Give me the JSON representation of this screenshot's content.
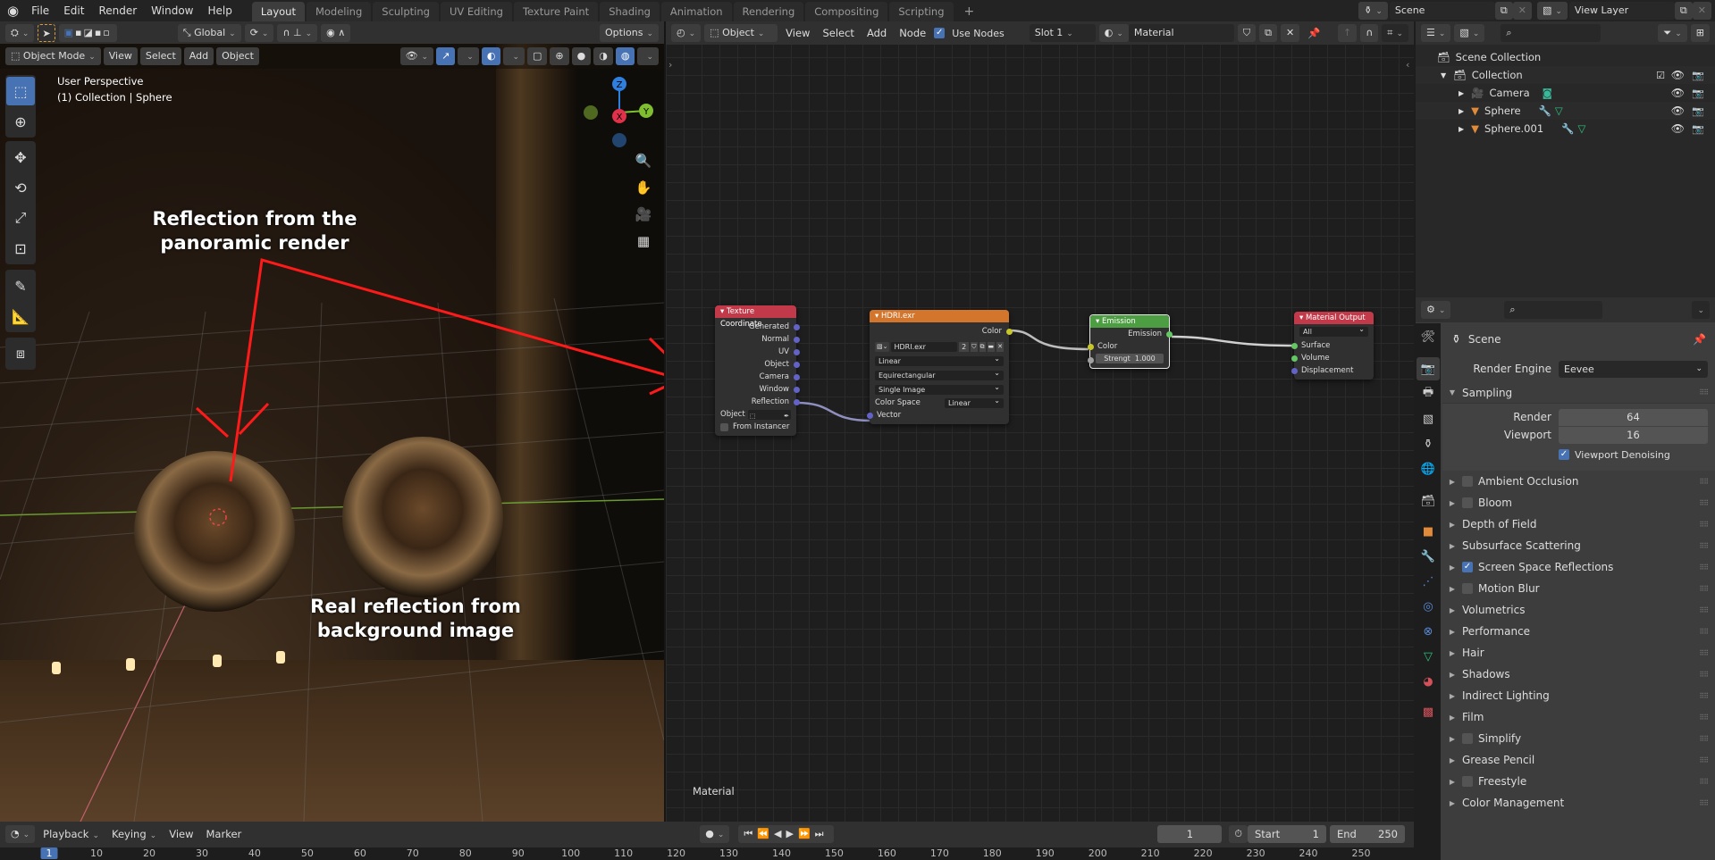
{
  "topbar": {
    "menus": [
      "File",
      "Edit",
      "Render",
      "Window",
      "Help"
    ],
    "workspaces": [
      "Layout",
      "Modeling",
      "Sculpting",
      "UV Editing",
      "Texture Paint",
      "Shading",
      "Animation",
      "Rendering",
      "Compositing",
      "Scripting"
    ],
    "active_workspace": "Layout",
    "add_tab": "+",
    "scene_name": "Scene",
    "view_layer": "View Layer"
  },
  "tool_header": {
    "transform_orientation": "Global",
    "options": "Options"
  },
  "viewport": {
    "mode": "Object Mode",
    "menus": [
      "View",
      "Select",
      "Add",
      "Object"
    ],
    "perspective": "User Perspective",
    "collection_info": "(1) Collection | Sphere",
    "gizmo_axes": {
      "z": "Z",
      "x": "X",
      "y": "Y"
    },
    "annotation_top": "Reflection from the panoramic render",
    "annotation_top_lines": [
      "Reflection from the",
      "panoramic render"
    ],
    "annotation_bottom_lines": [
      "Real reflection from",
      "background image"
    ]
  },
  "node_editor": {
    "object_type": "Object",
    "menus": [
      "View",
      "Select",
      "Add",
      "Node"
    ],
    "use_nodes_label": "Use Nodes",
    "use_nodes": true,
    "slot": "Slot 1",
    "material_name": "Material",
    "footer_label": "Material",
    "nodes": {
      "texcoord": {
        "title": "Texture Coordinate",
        "outputs": [
          "Generated",
          "Normal",
          "UV",
          "Object",
          "Camera",
          "Window",
          "Reflection"
        ],
        "object_label": "Object",
        "from_instancer": "From Instancer"
      },
      "image": {
        "title": "HDRI.exr",
        "output": "Color",
        "image_name": "HDRI.exr",
        "users": "2",
        "interpolation": "Linear",
        "projection": "Equirectangular",
        "source": "Single Image",
        "color_space_label": "Color Space",
        "color_space": "Linear",
        "input": "Vector"
      },
      "emission": {
        "title": "Emission",
        "output": "Emission",
        "color_input": "Color",
        "strength_label": "Strengt",
        "strength": "1.000"
      },
      "output": {
        "title": "Material Output",
        "target": "All",
        "inputs": [
          "Surface",
          "Volume",
          "Displacement"
        ]
      }
    }
  },
  "outliner": {
    "root": "Scene Collection",
    "collection": "Collection",
    "items": [
      "Camera",
      "Sphere",
      "Sphere.001"
    ]
  },
  "properties": {
    "context": "Scene",
    "render_engine_label": "Render Engine",
    "render_engine": "Eevee",
    "sampling": {
      "title": "Sampling",
      "render_label": "Render",
      "render": "64",
      "viewport_label": "Viewport",
      "viewport": "16",
      "denoising_label": "Viewport Denoising",
      "denoising": true
    },
    "panels": [
      {
        "label": "Ambient Occlusion",
        "checkbox": false
      },
      {
        "label": "Bloom",
        "checkbox": false
      },
      {
        "label": "Depth of Field"
      },
      {
        "label": "Subsurface Scattering"
      },
      {
        "label": "Screen Space Reflections",
        "checkbox": true
      },
      {
        "label": "Motion Blur",
        "checkbox": false
      },
      {
        "label": "Volumetrics"
      },
      {
        "label": "Performance"
      },
      {
        "label": "Hair"
      },
      {
        "label": "Shadows"
      },
      {
        "label": "Indirect Lighting"
      },
      {
        "label": "Film"
      },
      {
        "label": "Simplify",
        "checkbox": false
      },
      {
        "label": "Grease Pencil"
      },
      {
        "label": "Freestyle",
        "checkbox": false
      },
      {
        "label": "Color Management"
      }
    ]
  },
  "timeline": {
    "menus": [
      "Playback",
      "Keying",
      "View",
      "Marker"
    ],
    "current_frame": "1",
    "start_label": "Start",
    "start": "1",
    "end_label": "End",
    "end": "250",
    "ruler": [
      "1",
      "10",
      "20",
      "30",
      "40",
      "50",
      "60",
      "70",
      "80",
      "90",
      "100",
      "110",
      "120",
      "130",
      "140",
      "150",
      "160",
      "170",
      "180",
      "190",
      "200",
      "210",
      "220",
      "230",
      "240",
      "250"
    ]
  },
  "colors": {
    "accent": "#4772b3",
    "texcoord_header": "#c23a4a",
    "image_header": "#d4752c",
    "emission_header": "#4d9e43",
    "output_header": "#c23a4a",
    "socket_vector": "#6363c7",
    "socket_color": "#c7c729",
    "socket_shader": "#63c763",
    "annotation_red": "#ff1a1a"
  }
}
